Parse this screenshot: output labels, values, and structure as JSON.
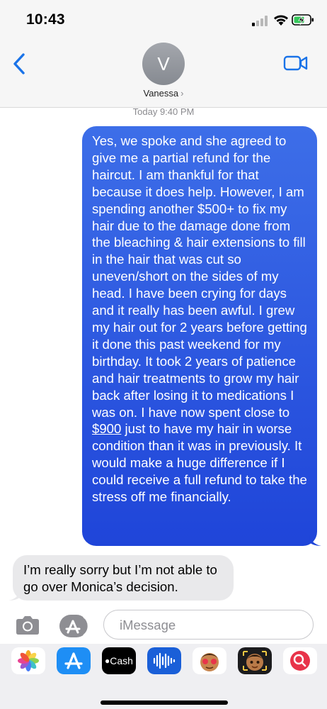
{
  "status_bar": {
    "time": "10:43"
  },
  "header": {
    "avatar_initial": "V",
    "contact_name": "Vanessa",
    "chevron": "›"
  },
  "conversation": {
    "timestamp_day": "Today",
    "timestamp_time": "9:40 PM",
    "messages": [
      {
        "direction": "outgoing",
        "text_before_link": "Yes, we spoke and she agreed to give me a partial refund for the haircut. I am thankful for that because it does help. However, I am spending another $500+ to fix my hair due to the damage done from the bleaching & hair extensions to fill in the hair that was cut so uneven/short on the sides of my head. I have been crying for days and it really has been awful. I grew my hair out for 2 years before getting it done this past weekend for my birthday. It took 2 years of patience and hair treatments to grow my hair back after losing it to medications I was on. I have now spent close to ",
        "link_text": "$900",
        "text_after_link": " just to have my hair in worse condition than it was in previously. It would make a huge difference if I could receive a full refund to take the stress off me financially."
      },
      {
        "direction": "incoming",
        "text": "I’m really sorry but I’m not able to go over Monica’s decision."
      }
    ]
  },
  "input_bar": {
    "placeholder": "iMessage"
  },
  "app_drawer": {
    "apps": [
      "photos-app-icon",
      "app-store-icon",
      "apple-cash-icon",
      "audio-message-icon",
      "memoji-stickers-icon",
      "animoji-icon",
      "web-search-icon"
    ],
    "cash_label": "Cash"
  },
  "colors": {
    "outgoing_bubble": "#2f5be3",
    "incoming_bubble": "#e9e9eb",
    "accent_blue": "#1a73e8"
  }
}
